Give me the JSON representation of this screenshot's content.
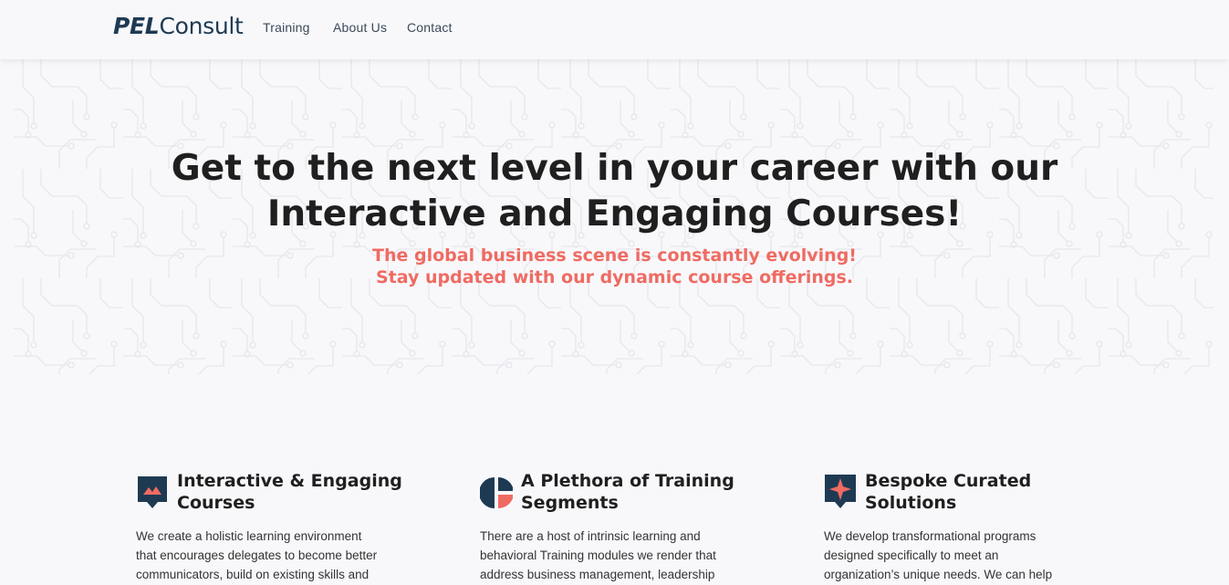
{
  "brand": {
    "bold": "PEL",
    "light": "Consult"
  },
  "nav": [
    {
      "label": "Training"
    },
    {
      "label": "About Us"
    },
    {
      "label": "Contact"
    }
  ],
  "hero": {
    "title_line1": "Get to the next level in your career with our",
    "title_line2": "Interactive and Engaging Courses!",
    "subtitle_line1": "The global business scene is constantly evolving!",
    "subtitle_line2": "Stay updated with our dynamic course offerings."
  },
  "features": [
    {
      "title_line1": "Interactive & Engaging",
      "title_line2": "Courses",
      "text_line1": "We create a holistic learning environment",
      "text_line2": "that encourages delegates to become better",
      "text_line3": "communicators, build on existing skills and",
      "icon": "chat-image-icon"
    },
    {
      "title_line1": "A Plethora of Training",
      "title_line2": "Segments",
      "text_line1": "There are a host of intrinsic learning and",
      "text_line2": "behavioral Training modules we render that",
      "text_line3": "address business management, leadership",
      "icon": "pie-chart-icon"
    },
    {
      "title_line1": "Bespoke Curated",
      "title_line2": "Solutions",
      "text_line1": "We develop transformational programs",
      "text_line2": "designed specifically to meet an",
      "text_line3": "organization’s unique needs. We can help",
      "icon": "star-badge-icon"
    }
  ],
  "colors": {
    "navy": "#1e3a52",
    "accent": "#ef6b62",
    "background": "#f8f8fb"
  }
}
